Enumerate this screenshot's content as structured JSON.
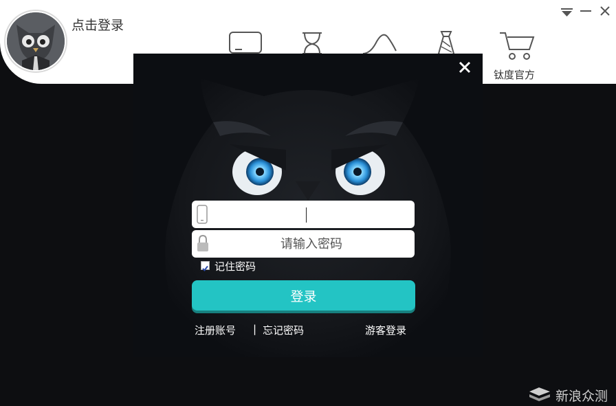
{
  "header": {
    "login_link": "点击登录",
    "nav_label": "钛度官方"
  },
  "dialog": {
    "password_placeholder": "请输入密码",
    "remember_label": "记住密码",
    "remember_checked": true,
    "login_button": "登录",
    "register_link": "注册账号",
    "separator": "|",
    "forgot_link": "忘记密码",
    "guest_link": "游客登录"
  },
  "watermark": {
    "text": "新浪众测"
  },
  "colors": {
    "accent": "#23c4c4",
    "background": "#0d0e11",
    "topbar": "#ffffff"
  },
  "icons": [
    "minimize-to-tray-icon",
    "minimize-icon",
    "close-icon",
    "monitor-icon",
    "hourglass-icon",
    "curve-icon",
    "tie-icon",
    "shopping-cart-icon",
    "phone-icon",
    "lock-icon",
    "owl-mascot"
  ]
}
